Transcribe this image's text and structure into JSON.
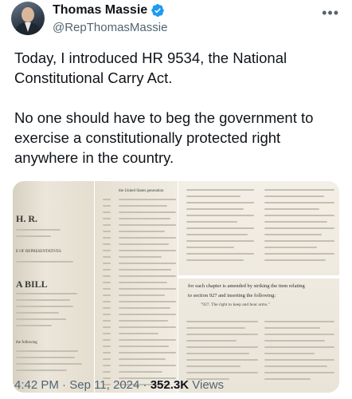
{
  "author": {
    "name": "Thomas Massie",
    "handle": "@RepThomasMassie",
    "verified_color": "#1d9bf0"
  },
  "tweet": {
    "paragraph1": "Today, I introduced HR 9534, the National Constitutional Carry Act.",
    "paragraph2": "No one should have to beg the government to exercise a constitutionally protected right anywhere in the country."
  },
  "media": {
    "doc_a": {
      "hr": "H. R.",
      "representatives": "E OF REPRESENTATIVES",
      "bill": "A BILL",
      "first_line_tip": "the following"
    },
    "doc_b": {
      "first_line": "the United States generation"
    },
    "doc_c": {
      "mid_text_1": "for each chapter is amended by striking the item relating",
      "mid_text_2": "to section 927 and inserting the following:",
      "mid_text_3": "\"927. The right to keep and bear arms.\""
    }
  },
  "meta": {
    "time": "4:42 PM",
    "separator": " · ",
    "date": "Sep 11, 2024",
    "views_count": "352.3K",
    "views_label": "Views"
  },
  "icons": {
    "more": "more-options-icon",
    "verified": "verified-badge-icon"
  }
}
